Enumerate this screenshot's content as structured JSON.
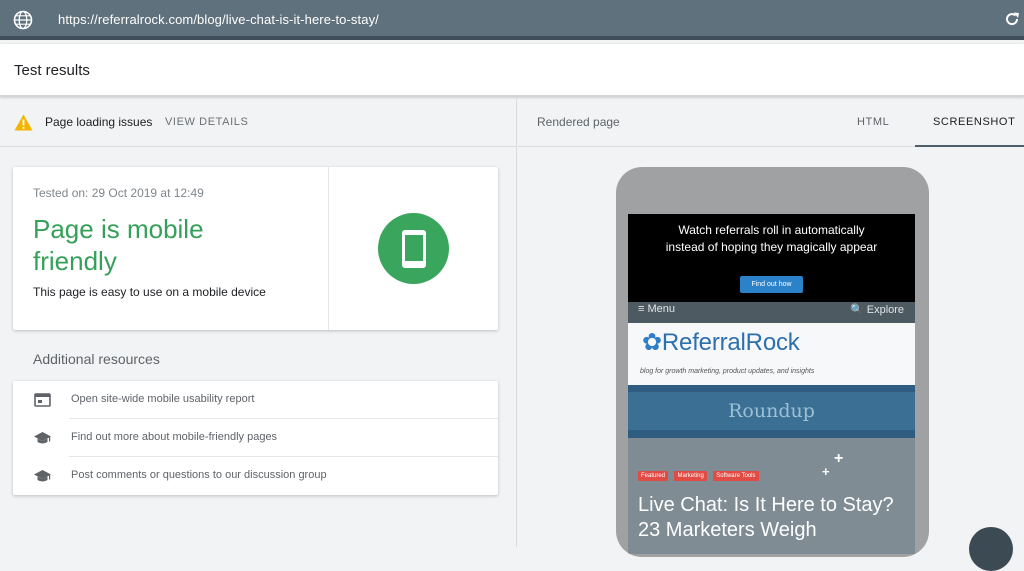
{
  "browser": {
    "url": "https://referralrock.com/blog/live-chat-is-it-here-to-stay/",
    "globe_icon": "globe-icon",
    "reload_icon": "reload-icon"
  },
  "header": {
    "title": "Test results"
  },
  "issues": {
    "label": "Page loading issues",
    "action": "VIEW DETAILS",
    "icon": "warning-icon",
    "icon_color": "#f4b400"
  },
  "result": {
    "tested_on": "Tested on: 29 Oct 2019 at 12:49",
    "verdict": "Page is mobile friendly",
    "subtext": "This page is easy to use on a mobile device",
    "badge_icon": "mobile-phone-icon",
    "verdict_color": "#36a05a"
  },
  "resources": {
    "title": "Additional resources",
    "items": [
      {
        "label": "Open site-wide mobile usability report",
        "icon": "report-icon"
      },
      {
        "label": "Find out more about mobile-friendly pages",
        "icon": "school-icon"
      },
      {
        "label": "Post comments or questions to our discussion group",
        "icon": "school-icon"
      }
    ]
  },
  "preview": {
    "title": "Rendered page",
    "tabs": [
      "HTML",
      "SCREENSHOT"
    ],
    "active_tab": "SCREENSHOT"
  },
  "phone_page": {
    "promo_text": "Watch referrals roll in automatically instead of hoping they magically appear",
    "promo_button": "Find out how",
    "nav_menu": "≡ Menu",
    "nav_explore": "🔍 Explore",
    "brand_name": "ReferralRock",
    "brand_tagline": "blog for growth marketing, product updates, and insights",
    "section": "Roundup",
    "tags": [
      "Featured",
      "Marketing",
      "Software Tools"
    ],
    "post_title": "Live Chat: Is It Here to Stay? 23 Marketers Weigh"
  }
}
